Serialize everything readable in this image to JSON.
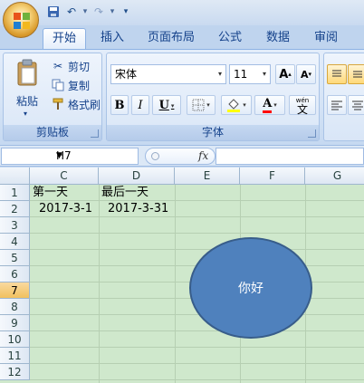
{
  "quick_access": {
    "save_icon": "save-icon",
    "undo_icon": "undo-icon",
    "redo_icon": "redo-icon",
    "customize_icon": "customize-icon"
  },
  "tabs": [
    {
      "label": "开始",
      "active": true
    },
    {
      "label": "插入"
    },
    {
      "label": "页面布局"
    },
    {
      "label": "公式"
    },
    {
      "label": "数据"
    },
    {
      "label": "审阅"
    }
  ],
  "clipboard": {
    "paste_label": "粘贴",
    "cut_label": "剪切",
    "copy_label": "复制",
    "format_painter_label": "格式刷",
    "group_label": "剪贴板"
  },
  "font": {
    "font_name": "宋体",
    "font_size": "11",
    "grow_label": "A",
    "shrink_label": "A",
    "bold": "B",
    "italic": "I",
    "underline": "U",
    "font_color_label": "A",
    "phonetic_label": "wén",
    "phonetic_char": "文",
    "group_label": "字体"
  },
  "formula_bar": {
    "name_box": "H7",
    "fx_label": "fx",
    "formula": ""
  },
  "sheet": {
    "columns": [
      "C",
      "D",
      "E",
      "F",
      "G"
    ],
    "rows": [
      "1",
      "2",
      "3",
      "4",
      "5",
      "6",
      "7",
      "8",
      "9",
      "10",
      "11",
      "12"
    ],
    "active_row": "7",
    "cells": {
      "C1": "第一天",
      "D1": "最后一天",
      "C2": "2017-3-1",
      "D2": "2017-3-31"
    },
    "shape_text": "你好"
  },
  "colors": {
    "shape_fill": "#4f81bd",
    "sheet_bg": "#cfe8cc",
    "ribbon_bg": "#d4e3f6"
  }
}
